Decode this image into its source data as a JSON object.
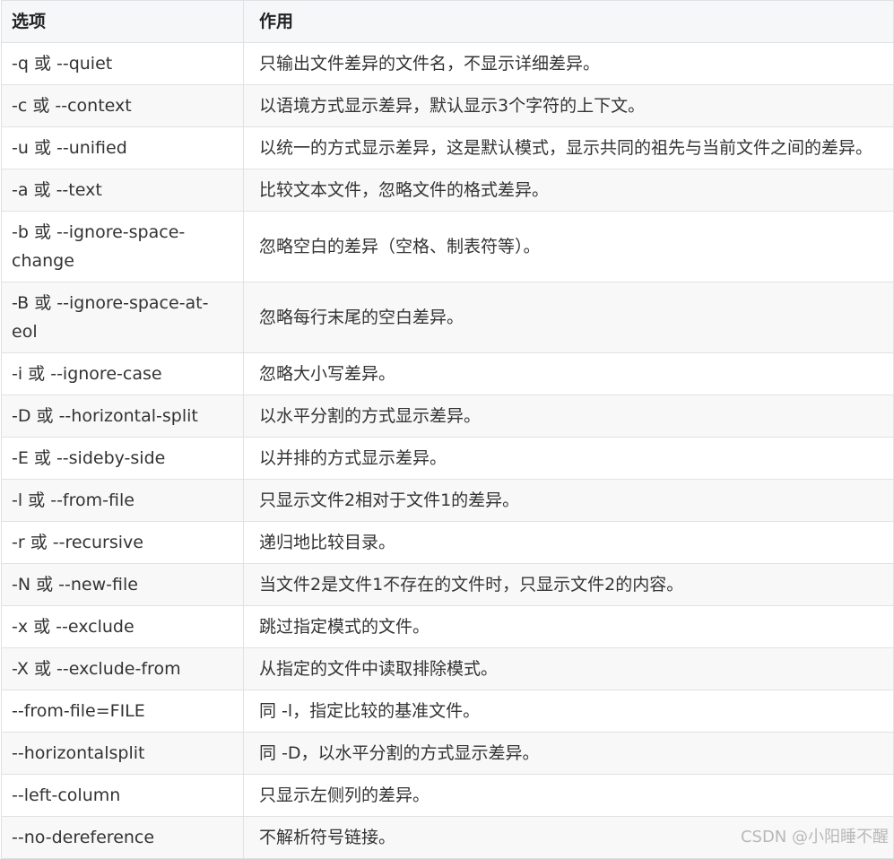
{
  "table": {
    "headers": [
      "选项",
      "作用"
    ],
    "rows": [
      [
        "-q 或 --quiet",
        "只输出文件差异的文件名，不显示详细差异。"
      ],
      [
        "-c 或 --context",
        "以语境方式显示差异，默认显示3个字符的上下文。"
      ],
      [
        "-u 或 --unified",
        "以统一的方式显示差异，这是默认模式，显示共同的祖先与当前文件之间的差异。"
      ],
      [
        "-a 或 --text",
        "比较文本文件，忽略文件的格式差异。"
      ],
      [
        "-b 或 --ignore-space-change",
        "忽略空白的差异（空格、制表符等）。"
      ],
      [
        "-B 或 --ignore-space-at-eol",
        "忽略每行末尾的空白差异。"
      ],
      [
        "-i 或 --ignore-case",
        "忽略大小写差异。"
      ],
      [
        "-D 或 --horizontal-split",
        "以水平分割的方式显示差异。"
      ],
      [
        "-E 或 --sideby-side",
        "以并排的方式显示差异。"
      ],
      [
        "-l 或 --from-file",
        "只显示文件2相对于文件1的差异。"
      ],
      [
        "-r 或 --recursive",
        "递归地比较目录。"
      ],
      [
        "-N 或 --new-file",
        "当文件2是文件1不存在的文件时，只显示文件2的内容。"
      ],
      [
        "-x 或 --exclude",
        "跳过指定模式的文件。"
      ],
      [
        "-X 或 --exclude-from",
        "从指定的文件中读取排除模式。"
      ],
      [
        "--from-file=FILE",
        "同 -l，指定比较的基准文件。"
      ],
      [
        "--horizontalsplit",
        "同 -D，以水平分割的方式显示差异。"
      ],
      [
        "--left-column",
        "只显示左侧列的差异。"
      ],
      [
        "--no-dereference",
        "不解析符号链接。"
      ]
    ]
  },
  "watermark": "CSDN @小阳睡不醒"
}
